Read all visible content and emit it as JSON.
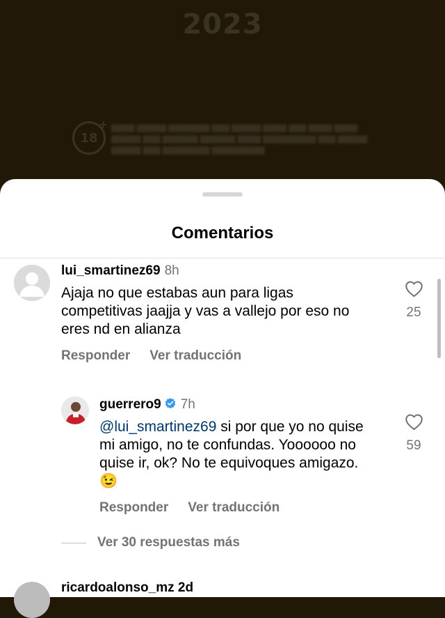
{
  "background_post": {
    "year": "2023",
    "age_badge": "18",
    "age_badge_plus": "+"
  },
  "sheet": {
    "title": "Comentarios"
  },
  "comments": [
    {
      "username": "lui_smartinez69",
      "time": "8h",
      "text": "Ajaja no que estabas aun para ligas competitivas jaajja y vas a vallejo por eso no eres nd en alianza",
      "like_count": "25",
      "reply_label": "Responder",
      "translate_label": "Ver traducción"
    },
    {
      "username": "guerrero9",
      "verified": true,
      "time": "7h",
      "mention": "@lui_smartinez69",
      "text": " si por que yo no quise mi amigo, no te confundas. Yoooooo no quise ir, ok? No te equivoques amigazo. 😉",
      "like_count": "59",
      "reply_label": "Responder",
      "translate_label": "Ver traducción"
    }
  ],
  "more_replies_label": "Ver 30 respuestas más",
  "next_comment_username_partial": "ricardoalonso_mz 2d",
  "colors": {
    "background": "#221807",
    "sheet": "#ffffff",
    "secondary_text": "#737373",
    "mention": "#00376b",
    "verified": "#3897f0"
  }
}
